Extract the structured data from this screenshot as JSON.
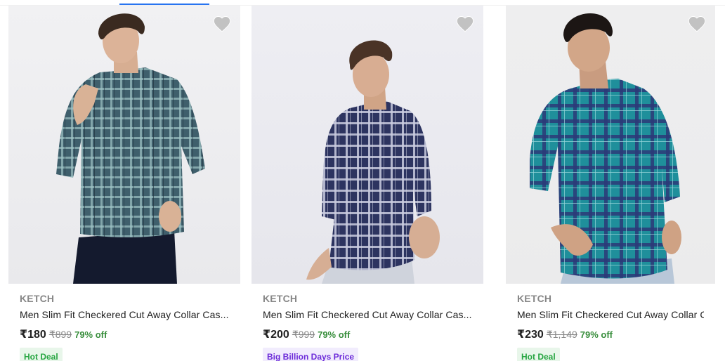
{
  "colors": {
    "accent": "#2874f0",
    "discount_green": "#388e3c",
    "wishlist_grey": "#c2c2c2",
    "hot_deal_bg": "#e8f6ea",
    "hot_deal_text": "#26a541",
    "bbd_bg": "#f1ecfd",
    "bbd_text": "#6c2bd9"
  },
  "products": [
    {
      "brand": "KETCH",
      "title": "Men Slim Fit Checkered Cut Away Collar Cas...",
      "price": "₹180",
      "mrp": "₹899",
      "discount": "79% off",
      "tag": "Hot Deal",
      "wishlist_icon": "heart-icon",
      "shirt_color": "#3f5f6c",
      "check_color": "#9fc3c5"
    },
    {
      "brand": "KETCH",
      "title": "Men Slim Fit Checkered Cut Away Collar Cas...",
      "price": "₹200",
      "mrp": "₹999",
      "discount": "79% off",
      "tag": "Big Billion Days Price",
      "wishlist_icon": "heart-icon",
      "shirt_color": "#2d3460",
      "check_color": "#c9ccdf"
    },
    {
      "brand": "KETCH",
      "title": "Men Slim Fit Checkered Cut Away Collar Cas...",
      "price": "₹230",
      "mrp": "₹1,149",
      "discount": "79% off",
      "tag": "Hot Deal",
      "wishlist_icon": "heart-icon",
      "shirt_color": "#1f8f9b",
      "check_color": "#2c3a78"
    }
  ]
}
